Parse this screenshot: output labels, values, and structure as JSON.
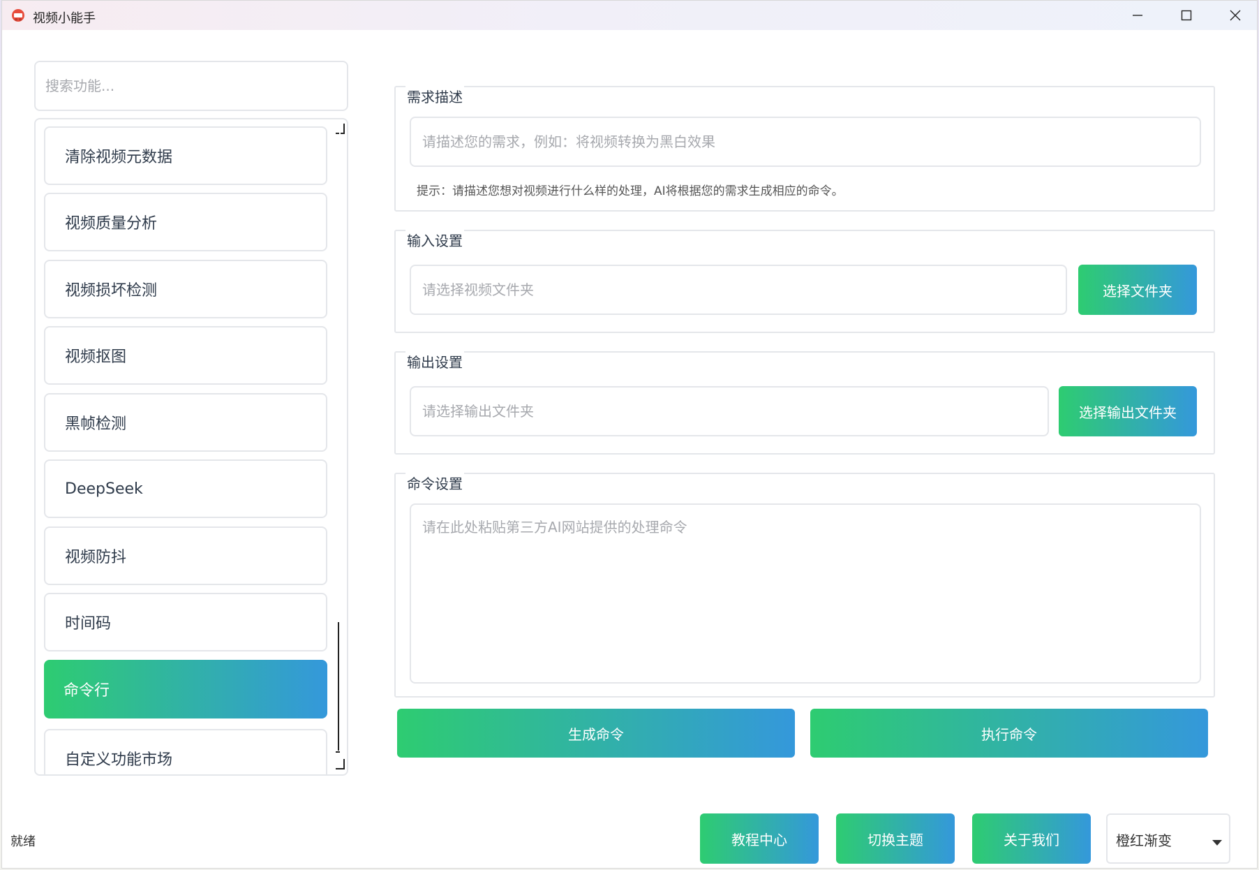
{
  "window": {
    "title": "视频小能手"
  },
  "sidebar": {
    "search_placeholder": "搜索功能...",
    "items": [
      {
        "label": "清除视频元数据",
        "active": false
      },
      {
        "label": "视频质量分析",
        "active": false
      },
      {
        "label": "视频损坏检测",
        "active": false
      },
      {
        "label": "视频抠图",
        "active": false
      },
      {
        "label": "黑帧检测",
        "active": false
      },
      {
        "label": "DeepSeek",
        "active": false
      },
      {
        "label": "视频防抖",
        "active": false
      },
      {
        "label": "时间码",
        "active": false
      },
      {
        "label": "命令行",
        "active": true
      },
      {
        "label": "自定义功能市场",
        "active": false
      }
    ]
  },
  "requirement": {
    "title": "需求描述",
    "placeholder": "请描述您的需求，例如：将视频转换为黑白效果",
    "hint": "提示：请描述您想对视频进行什么样的处理，AI将根据您的需求生成相应的命令。"
  },
  "input_settings": {
    "title": "输入设置",
    "placeholder": "请选择视频文件夹",
    "button": "选择文件夹"
  },
  "output_settings": {
    "title": "输出设置",
    "placeholder": "请选择输出文件夹",
    "button": "选择输出文件夹"
  },
  "command_settings": {
    "title": "命令设置",
    "placeholder": "请在此处粘贴第三方AI网站提供的处理命令"
  },
  "actions": {
    "generate": "生成命令",
    "execute": "执行命令"
  },
  "footer": {
    "status": "就绪",
    "tutorial": "教程中心",
    "switch_theme": "切换主题",
    "about": "关于我们",
    "theme_selected": "橙红渐变"
  },
  "colors": {
    "accent_start": "#2ecc71",
    "accent_end": "#3498db",
    "border": "#e4e6ea"
  }
}
